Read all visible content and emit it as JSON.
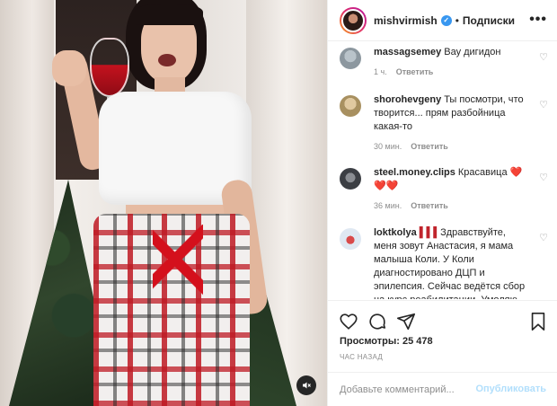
{
  "header": {
    "username": "mishvirmish",
    "verified_mark": "✓",
    "separator": "•",
    "follow_label": "Подписки",
    "more_label": "•••"
  },
  "comments": [
    {
      "username": "massagsemey",
      "text": "Вау дигидон",
      "time": "1 ч.",
      "reply_label": "Ответить",
      "avatar_color": "#9aa7b0"
    },
    {
      "username": "shorohevgeny",
      "text": "Ты посмотри, что творится... прям разбойница какая-то",
      "time": "30 мин.",
      "reply_label": "Ответить",
      "avatar_color": "#c8b27a"
    },
    {
      "username": "steel.money.clips",
      "text": "Красавица",
      "emoji": "❤️❤️❤️",
      "time": "36 мин.",
      "reply_label": "Ответить",
      "avatar_color": "#4a4d52"
    },
    {
      "username": "loktkolya",
      "prefix": "▌▌▌",
      "text": "Здравствуйте, меня зовут Анастасия, я мама малыша Коли. У Коли диагностировано ДЦП и эпилепсия. Сейчас ведётся сбор на курс реабилитации. Умоляю",
      "avatar_color": "#c2d3e6"
    }
  ],
  "actions": {
    "like_icon": "heart-outline-icon",
    "comment_icon": "comment-bubble-icon",
    "share_icon": "paper-plane-icon",
    "save_icon": "bookmark-icon"
  },
  "views_label": "Просмотры: 25 478",
  "time_ago": "ЧАС НАЗАД",
  "add_comment": {
    "placeholder": "Добавьте комментарий...",
    "publish_label": "Опубликовать"
  },
  "colors": {
    "accent": "#3897f0",
    "publish_disabled": "#b2dffc",
    "muted_text": "#8e8e8e",
    "heart_red": "#ed4956"
  }
}
